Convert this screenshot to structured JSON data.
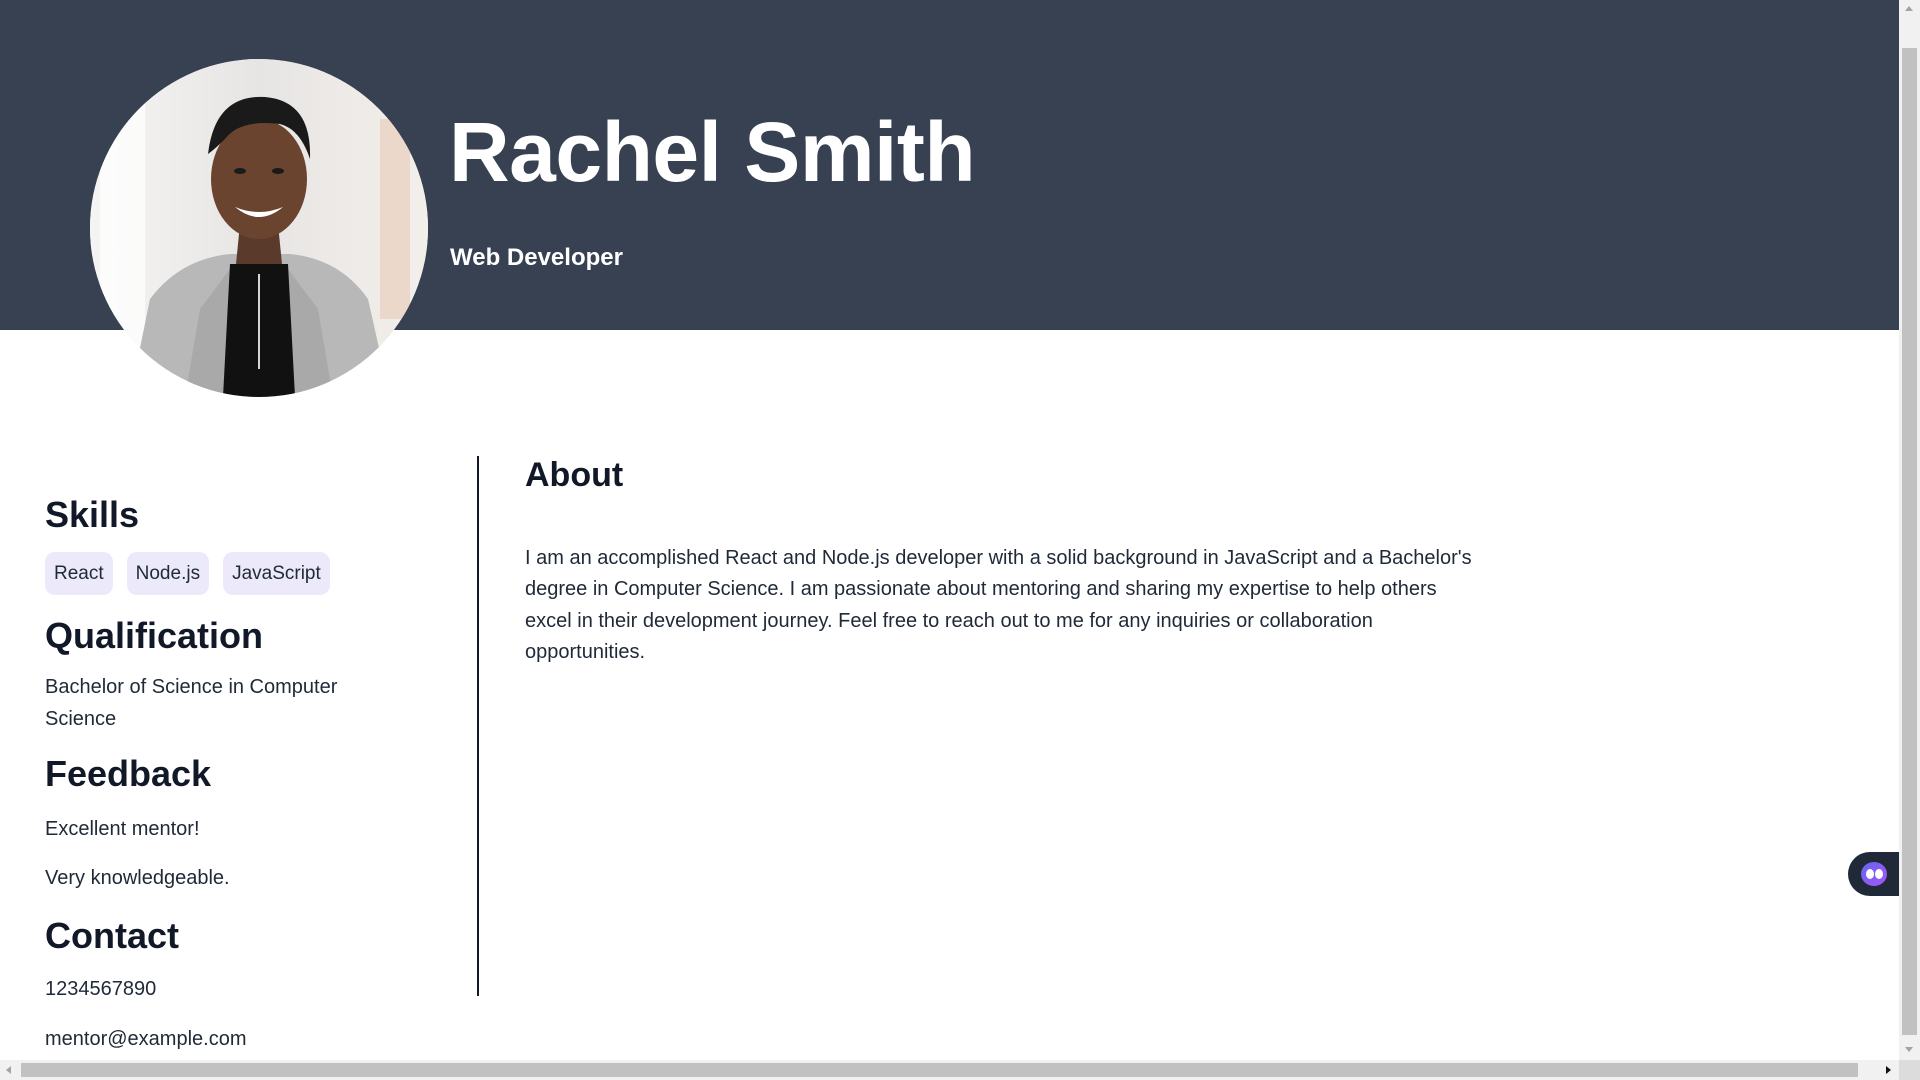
{
  "profile": {
    "name": "Rachel Smith",
    "role": "Web Developer",
    "avatar_alt": "Profile photo"
  },
  "sidebar": {
    "skills": {
      "heading": "Skills",
      "items": [
        "React",
        "Node.js",
        "JavaScript"
      ]
    },
    "qualification": {
      "heading": "Qualification",
      "text": "Bachelor of Science in Computer Science"
    },
    "feedback": {
      "heading": "Feedback",
      "items": [
        "Excellent mentor!",
        "Very knowledgeable."
      ]
    },
    "contact": {
      "heading": "Contact",
      "phone": "1234567890",
      "email": "mentor@example.com"
    }
  },
  "main": {
    "about": {
      "heading": "About",
      "text": "I am an accomplished React and Node.js developer with a solid background in JavaScript and a Bachelor's degree in Computer Science. I am passionate about mentoring and sharing my expertise to help others excel in their development journey. Feel free to reach out to me for any inquiries or collaboration opportunities."
    }
  },
  "colors": {
    "banner": "#374151",
    "chip_bg": "#ece9fb",
    "text": "#1f2937",
    "heading": "#111827"
  },
  "widget": {
    "icon": "assistant-face-icon"
  }
}
